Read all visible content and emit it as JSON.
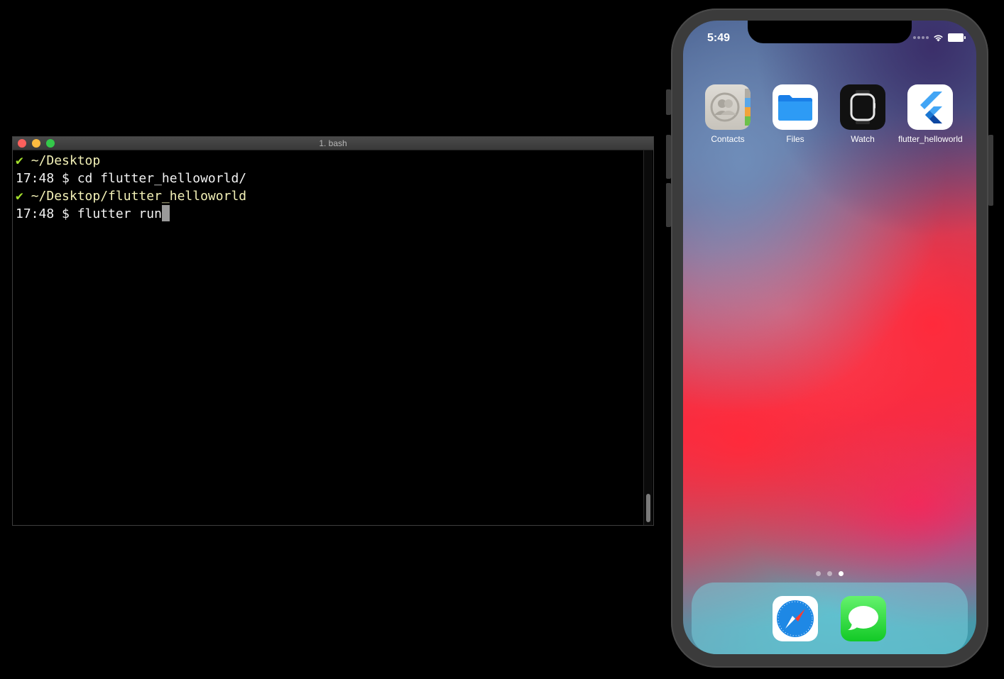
{
  "terminal": {
    "title": "1. bash",
    "lines": [
      {
        "check": "✔",
        "path": "~/Desktop"
      },
      {
        "prompt": "17:48 $",
        "command": "cd flutter_helloworld/"
      },
      {
        "check": "✔",
        "path": "~/Desktop/flutter_helloworld"
      },
      {
        "prompt": "17:48 $",
        "command": "flutter run"
      }
    ]
  },
  "phone": {
    "status_time": "5:49",
    "apps": [
      {
        "label": "Contacts",
        "icon": "contacts-icon"
      },
      {
        "label": "Files",
        "icon": "files-icon"
      },
      {
        "label": "Watch",
        "icon": "watch-icon"
      },
      {
        "label": "flutter_helloworld",
        "icon": "flutter-icon"
      }
    ],
    "page_indicator": {
      "pages": 3,
      "current": 3
    },
    "dock": [
      {
        "icon": "safari-icon"
      },
      {
        "icon": "messages-icon"
      }
    ]
  },
  "colors": {
    "check": "#a6e22e",
    "path": "#f3f1b7",
    "traffic_close": "#fc605c",
    "traffic_minimize": "#fdbc40",
    "traffic_maximize": "#34c84a"
  }
}
